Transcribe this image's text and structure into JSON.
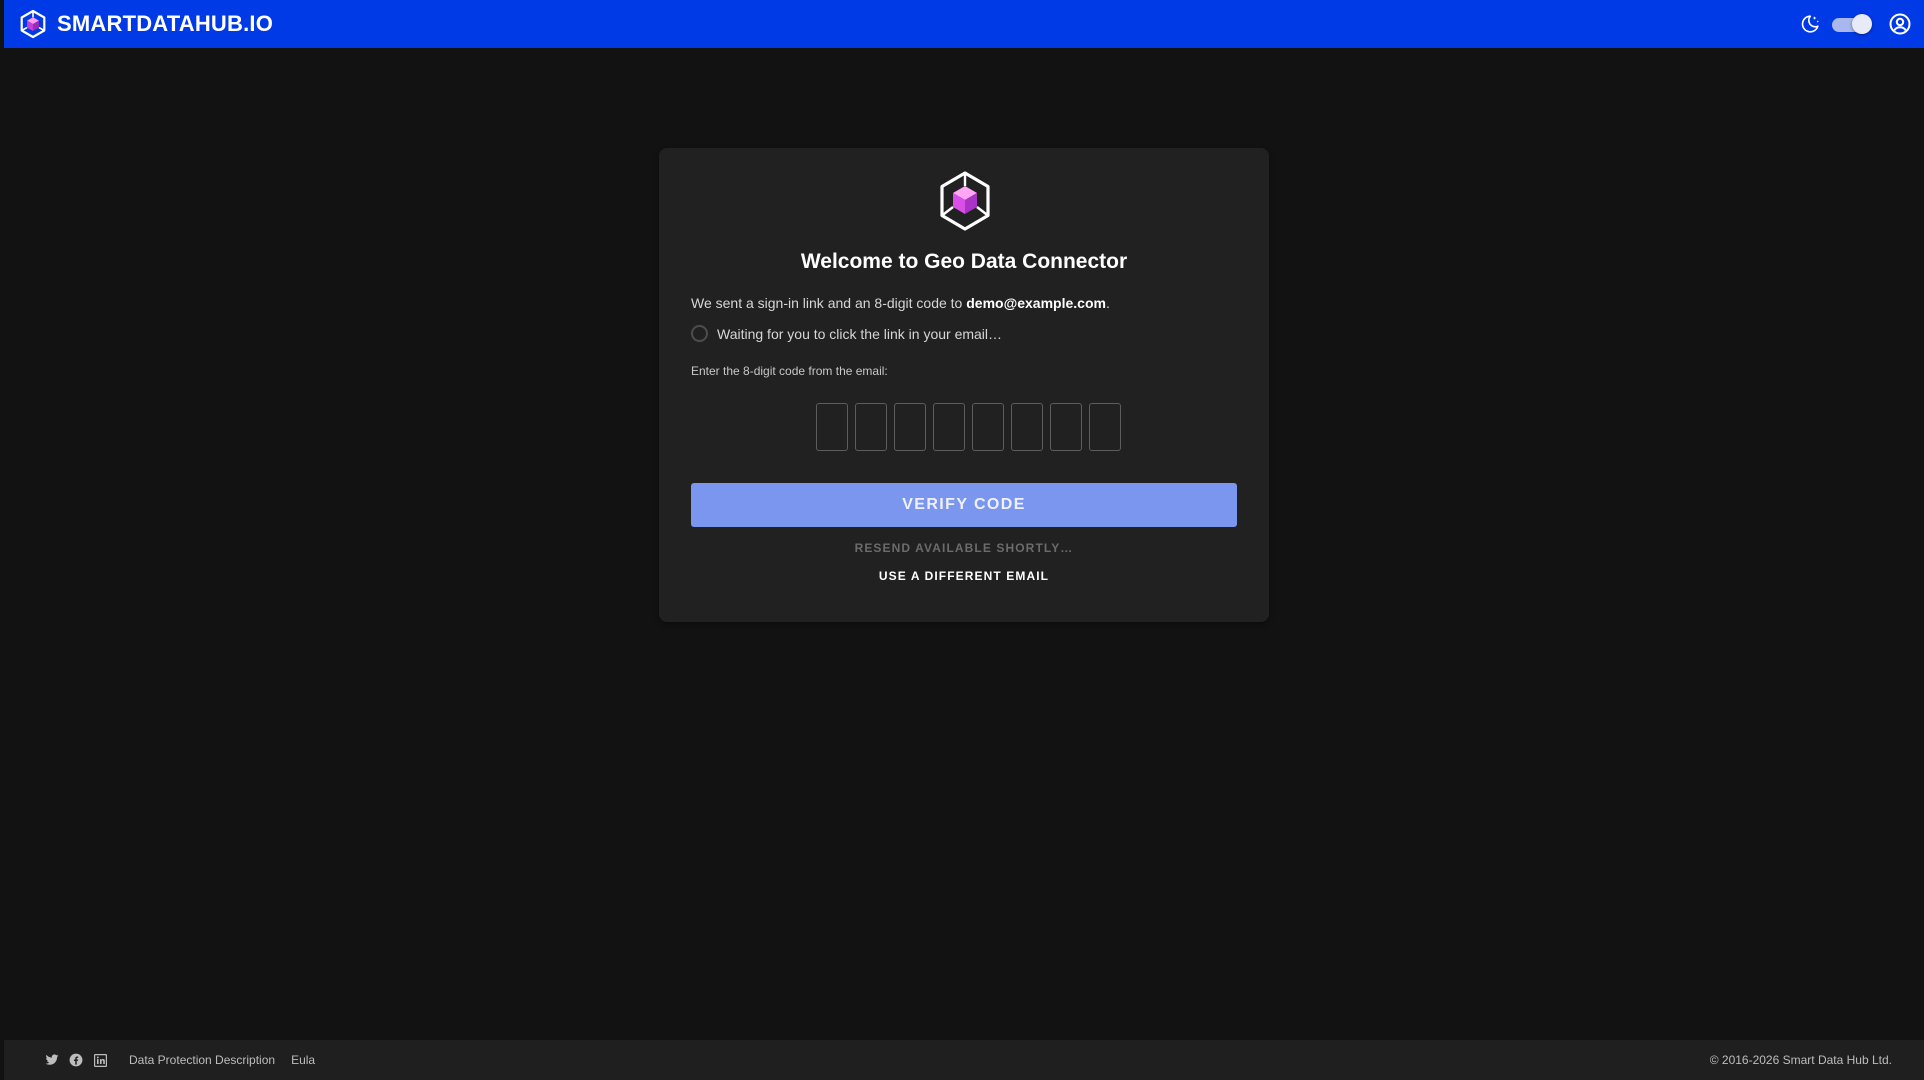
{
  "topbar": {
    "brand": "SMARTDATAHUB.IO",
    "brand_logo": "cube-logo-icon",
    "theme_icon": "moon-stars-icon",
    "theme_switch_on": true,
    "account_icon": "account-circle-icon",
    "background_color": "#0039e6"
  },
  "card": {
    "logo_icon": "cube-logo-icon",
    "title": "Welcome to Geo Data Connector",
    "sent_prefix": "We sent a sign-in link and an 8-digit code to ",
    "email": "demo@example.com",
    "sent_suffix": ".",
    "waiting_text": "Waiting for you to click the link in your email…",
    "code_label": "Enter the 8-digit code from the email:",
    "code_digits": [
      "",
      "",
      "",
      "",
      "",
      "",
      "",
      ""
    ],
    "verify_label": "VERIFY CODE",
    "resend_label": "RESEND AVAILABLE SHORTLY…",
    "different_email_label": "USE A DIFFERENT EMAIL",
    "accent_color": "#7b96ef"
  },
  "footer": {
    "social_icons": [
      "twitter-icon",
      "facebook-icon",
      "linkedin-icon"
    ],
    "links": [
      "Data Protection Description",
      "Eula"
    ],
    "copyright": "© 2016-2026 Smart Data Hub Ltd."
  }
}
